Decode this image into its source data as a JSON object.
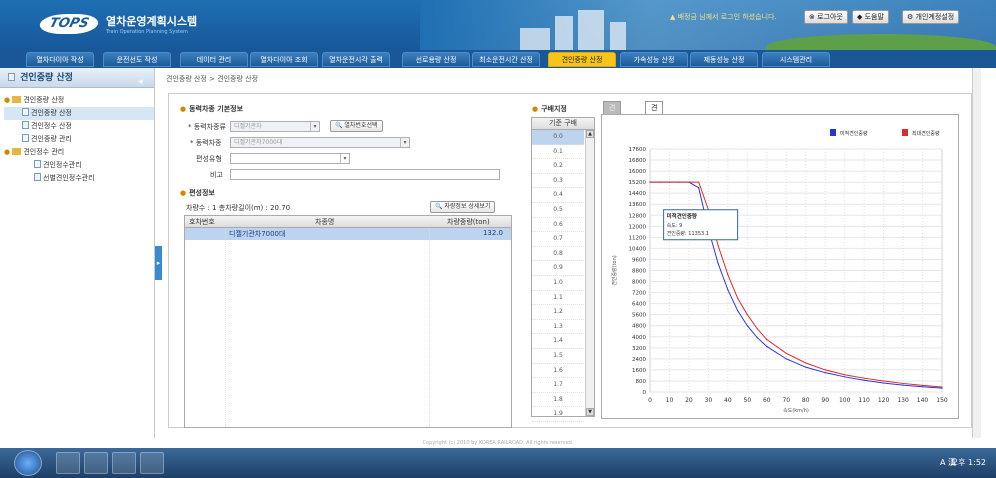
{
  "header": {
    "logo_text": "TOPS",
    "title": "열차운영계획시스템",
    "subtitle": "Train Operation Planning System",
    "login_message": "배정금 님께서 로그인 하셨습니다.",
    "logout_label": "로그아웃",
    "help_label": "도움말",
    "personal_label": "개인계정설정"
  },
  "nav": {
    "tabs": [
      {
        "label": "열차다이아 작성",
        "active": false
      },
      {
        "label": "운전선도 작성",
        "active": false
      },
      {
        "label": "데이터 관리",
        "active": false
      },
      {
        "label": "열차다이아 조회",
        "active": false
      },
      {
        "label": "열차운전시각 출력",
        "active": false
      },
      {
        "label": "선로용량 산정",
        "active": false
      },
      {
        "label": "최소운전시간 산정",
        "active": false
      },
      {
        "label": "견인중량 산정",
        "active": true
      },
      {
        "label": "가속성능 산정",
        "active": false
      },
      {
        "label": "제동성능 산정",
        "active": false
      },
      {
        "label": "시스템관리",
        "active": false
      }
    ]
  },
  "sidebar": {
    "title": "견인중량 산정",
    "items": [
      {
        "label": "견인중량 산정",
        "type": "folder",
        "level": 0
      },
      {
        "label": "견인중량 산정",
        "type": "doc",
        "level": 1,
        "selected": true
      },
      {
        "label": "견인정수 산정",
        "type": "doc",
        "level": 1
      },
      {
        "label": "견인중량 관리",
        "type": "doc",
        "level": 1
      },
      {
        "label": "견인정수 관리",
        "type": "folder",
        "level": 0
      },
      {
        "label": "견인정수관리",
        "type": "doc",
        "level": 2
      },
      {
        "label": "선별견인정수관리",
        "type": "doc",
        "level": 2
      }
    ]
  },
  "breadcrumb": "견인중량 산정 > 견인중량 산정",
  "power_info": {
    "title": "동력차종 기본정보",
    "type_label": "* 동력차종류",
    "type_value": "디젤기관차",
    "search_btn": "열차번호선택",
    "car_label": "* 동력차종",
    "car_value": "디젤기관차7000대",
    "formation_label": "편성유형",
    "formation_value": "",
    "note_label": "비고",
    "note_value": ""
  },
  "formation": {
    "title": "편성정보",
    "summary": "차량수 : 1  총차량길이(m) : 20.70",
    "detail_btn": "차량정보 상세보기",
    "columns": [
      "호차번호",
      "차종명",
      "차량중량(ton)"
    ],
    "rows": [
      {
        "no": "",
        "name": "디젤기관차7000대",
        "weight": "132.0"
      }
    ]
  },
  "gradient": {
    "title": "구배지정",
    "header": "기준 구배",
    "values": [
      "0.0",
      "0.1",
      "0.2",
      "0.3",
      "0.4",
      "0.5",
      "0.6",
      "0.7",
      "0.8",
      "0.9",
      "1.0",
      "1.1",
      "1.2",
      "1.3",
      "1.4",
      "1.5",
      "1.6",
      "1.7",
      "1.8",
      "1.9"
    ]
  },
  "chart_tabs": {
    "tab1": "견인중량",
    "tab2": "견인특성곡선"
  },
  "chart_data": {
    "type": "line",
    "title": "",
    "xlabel": "속도(km/h)",
    "ylabel": "견인중량(ton)",
    "xlim": [
      0,
      150
    ],
    "ylim": [
      0,
      17600
    ],
    "x_ticks": [
      0,
      10,
      20,
      30,
      40,
      50,
      60,
      70,
      80,
      90,
      100,
      110,
      120,
      130,
      140,
      150
    ],
    "y_ticks": [
      0,
      800,
      1600,
      2400,
      3200,
      4000,
      4800,
      5600,
      6400,
      7200,
      8000,
      8800,
      9600,
      10400,
      11200,
      12000,
      12800,
      13600,
      14400,
      15200,
      16000,
      16800,
      17600
    ],
    "series": [
      {
        "name": "미적견인중량",
        "color": "#2a35d8",
        "x": [
          0,
          5,
          10,
          15,
          20,
          25,
          30,
          35,
          40,
          45,
          50,
          55,
          60,
          70,
          80,
          90,
          100,
          110,
          120,
          130,
          140,
          150
        ],
        "y": [
          15200,
          15200,
          15200,
          15200,
          15200,
          14800,
          11800,
          9300,
          7400,
          5900,
          4800,
          3950,
          3300,
          2400,
          1800,
          1400,
          1100,
          850,
          650,
          500,
          380,
          280
        ]
      },
      {
        "name": "최대견인중량",
        "color": "#e02a2a",
        "x": [
          0,
          5,
          10,
          15,
          20,
          25,
          30,
          35,
          40,
          45,
          50,
          55,
          60,
          70,
          80,
          90,
          100,
          110,
          120,
          130,
          140,
          150
        ],
        "y": [
          15200,
          15200,
          15200,
          15200,
          15200,
          15200,
          13200,
          10600,
          8500,
          6800,
          5600,
          4600,
          3800,
          2800,
          2100,
          1600,
          1250,
          1000,
          800,
          620,
          480,
          360
        ]
      }
    ],
    "tooltip": {
      "title": "미적견인중량",
      "line1": "속도: 9",
      "line2": "견인중량: 11353.1"
    },
    "legend_position": "top-right",
    "grid": true
  },
  "footer": "Copyright (c) 2010 by KOREA RAILROAD. All rights reserved.",
  "taskbar": {
    "tray_text": "A 漢",
    "clock": "오후 1:52"
  }
}
